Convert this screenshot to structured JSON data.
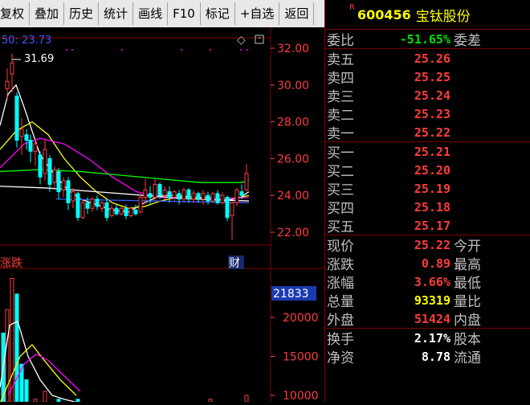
{
  "toolbar": {
    "items": [
      "复权",
      "叠加",
      "历史",
      "统计",
      "画线",
      "F10",
      "标记",
      "+自选",
      "返回"
    ]
  },
  "kline": {
    "ma_label": "50: 23.73",
    "high_label": "31.69",
    "price_ticks": [
      "32.00",
      "30.00",
      "28.00",
      "26.00",
      "24.00",
      "22.00"
    ],
    "mark_zhangdie": "涨跌",
    "mark_cai": "财"
  },
  "volume": {
    "current_box": "21833",
    "ticks": [
      "20000",
      "15000",
      "10000"
    ]
  },
  "quote": {
    "r_mark": "R",
    "code": "600456",
    "name": "宝钛股份",
    "weibi_label": "委比",
    "weibi_value": "-51.65%",
    "weicha_label": "委差",
    "sells": [
      {
        "label": "卖五",
        "price": "25.26"
      },
      {
        "label": "卖四",
        "price": "25.25"
      },
      {
        "label": "卖三",
        "price": "25.24"
      },
      {
        "label": "卖二",
        "price": "25.23"
      },
      {
        "label": "卖一",
        "price": "25.22"
      }
    ],
    "buys": [
      {
        "label": "买一",
        "price": "25.21"
      },
      {
        "label": "买二",
        "price": "25.20"
      },
      {
        "label": "买三",
        "price": "25.19"
      },
      {
        "label": "买四",
        "price": "25.18"
      },
      {
        "label": "买五",
        "price": "25.17"
      }
    ],
    "stats": [
      {
        "label": "现价",
        "value": "25.22",
        "label2": "今开",
        "color": "red"
      },
      {
        "label": "涨跌",
        "value": "0.89",
        "label2": "最高",
        "color": "red"
      },
      {
        "label": "涨幅",
        "value": "3.66%",
        "label2": "最低",
        "color": "red"
      },
      {
        "label": "总量",
        "value": "93319",
        "label2": "量比",
        "color": "yellow"
      },
      {
        "label": "外盘",
        "value": "51424",
        "label2": "内盘",
        "color": "red"
      }
    ],
    "extra": [
      {
        "label": "换手",
        "value": "2.17%",
        "label2": "股本",
        "color": "white"
      },
      {
        "label": "净资",
        "value": "8.78",
        "label2": "流通",
        "color": "white"
      }
    ]
  },
  "colors": {
    "up": "#ff3c3c",
    "down": "#00ffff",
    "grid": "#800000",
    "ma5": "#ffffff",
    "ma10": "#ffff00",
    "ma20": "#ff00ff",
    "ma60": "#00ff00"
  }
}
